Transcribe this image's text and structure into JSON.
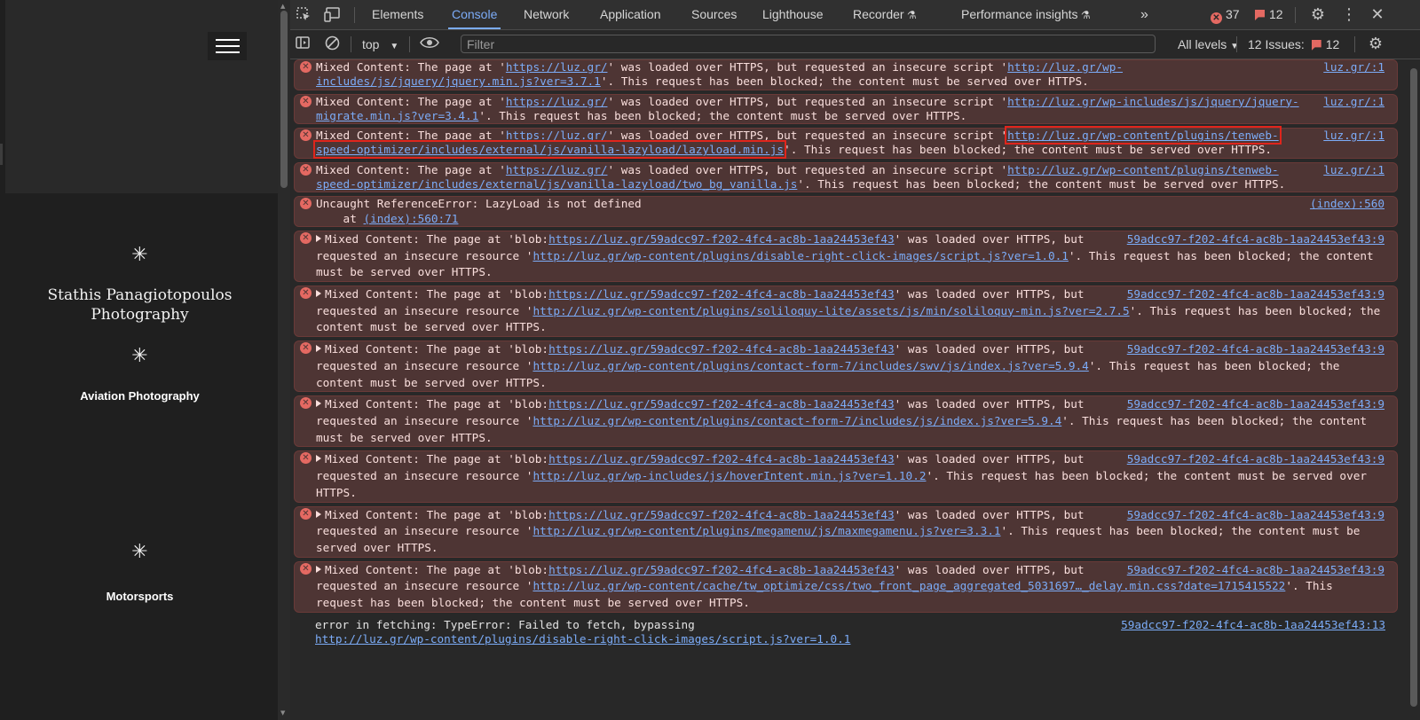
{
  "site": {
    "star": "✳",
    "name_line1": "Stathis Panagiotopoulos",
    "name_line2": "Photography",
    "category1": "Aviation Photography",
    "category2": "Motorsports"
  },
  "devtools": {
    "tabs": [
      "Elements",
      "Console",
      "Network",
      "Application",
      "Sources",
      "Lighthouse",
      "Recorder",
      "Performance insights"
    ],
    "active_tab": "Console",
    "more_tabs": "»",
    "error_count": "37",
    "issue_count": "12",
    "context": "top",
    "filter_placeholder": "Filter",
    "levels": "All levels",
    "issues_label": "12 Issues:",
    "issues_badge": "12"
  },
  "messages": [
    {
      "pre": "Mixed Content: The page at '",
      "page": "https://luz.gr/",
      "mid": "' was loaded over HTTPS, but requested an insecure script '",
      "res": "http://luz.gr/wp-includes/js/jquery/jquery.min.js?ver=3.7.1",
      "post": "'. This request has been blocked; the content must be served over HTTPS.",
      "source": "luz.gr/:1"
    },
    {
      "pre": "Mixed Content: The page at '",
      "page": "https://luz.gr/",
      "mid": "' was loaded over HTTPS, but requested an insecure script '",
      "res": "http://luz.gr/wp-includes/js/jquery/jquery-migrate.min.js?ver=3.4.1",
      "post": "'. This request has been blocked; the content must be served over HTTPS.",
      "source": "luz.gr/:1"
    },
    {
      "pre": "Mixed Content: The page at '",
      "page": "https://luz.gr/",
      "mid": "' was loaded over HTTPS, but requested an insecure script '",
      "res": "http://luz.gr/wp-content/plugins/tenweb-speed-optimizer/includes/external/js/vanilla-lazyload/lazyload.min.js",
      "post": "'. This request has been blocked; the content must be served over HTTPS.",
      "source": "luz.gr/:1"
    },
    {
      "pre": "Mixed Content: The page at '",
      "page": "https://luz.gr/",
      "mid": "' was loaded over HTTPS, but requested an insecure script '",
      "res": "http://luz.gr/wp-content/plugins/tenweb-speed-optimizer/includes/external/js/vanilla-lazyload/two_bg_vanilla.js",
      "post": "'. This request has been blocked; the content must be served over HTTPS.",
      "source": "luz.gr/:1"
    },
    {
      "text": "Uncaught ReferenceError: LazyLoad is not defined",
      "at_prefix": "    at ",
      "at_link": "(index):560:71",
      "source": "(index):560"
    },
    {
      "pre": "Mixed Content: The page at 'blob:",
      "page": "https://luz.gr/59adcc97-f202-4fc4-ac8b-1aa24453ef43",
      "mid": "' was loaded over HTTPS, but requested an insecure resource '",
      "res": "http://luz.gr/wp-content/plugins/disable-right-click-images/script.js?ver=1.0.1",
      "post": "'. This request has been blocked; the content must be served over HTTPS.",
      "source": "59adcc97-f202-4fc4-ac8b-1aa24453ef43:9"
    },
    {
      "pre": "Mixed Content: The page at 'blob:",
      "page": "https://luz.gr/59adcc97-f202-4fc4-ac8b-1aa24453ef43",
      "mid": "' was loaded over HTTPS, but requested an insecure resource '",
      "res": "http://luz.gr/wp-content/plugins/soliloquy-lite/assets/js/min/soliloquy-min.js?ver=2.7.5",
      "post": "'. This request has been blocked; the content must be served over HTTPS.",
      "source": "59adcc97-f202-4fc4-ac8b-1aa24453ef43:9"
    },
    {
      "pre": "Mixed Content: The page at 'blob:",
      "page": "https://luz.gr/59adcc97-f202-4fc4-ac8b-1aa24453ef43",
      "mid": "' was loaded over HTTPS, but requested an insecure resource '",
      "res": "http://luz.gr/wp-content/plugins/contact-form-7/includes/swv/js/index.js?ver=5.9.4",
      "post": "'. This request has been blocked; the content must be served over HTTPS.",
      "source": "59adcc97-f202-4fc4-ac8b-1aa24453ef43:9"
    },
    {
      "pre": "Mixed Content: The page at 'blob:",
      "page": "https://luz.gr/59adcc97-f202-4fc4-ac8b-1aa24453ef43",
      "mid": "' was loaded over HTTPS, but requested an insecure resource '",
      "res": "http://luz.gr/wp-content/plugins/contact-form-7/includes/js/index.js?ver=5.9.4",
      "post": "'. This request has been blocked; the content must be served over HTTPS.",
      "source": "59adcc97-f202-4fc4-ac8b-1aa24453ef43:9"
    },
    {
      "pre": "Mixed Content: The page at 'blob:",
      "page": "https://luz.gr/59adcc97-f202-4fc4-ac8b-1aa24453ef43",
      "mid": "' was loaded over HTTPS, but requested an insecure resource '",
      "res": "http://luz.gr/wp-includes/js/hoverIntent.min.js?ver=1.10.2",
      "post": "'. This request has been blocked; the content must be served over HTTPS.",
      "source": "59adcc97-f202-4fc4-ac8b-1aa24453ef43:9"
    },
    {
      "pre": "Mixed Content: The page at 'blob:",
      "page": "https://luz.gr/59adcc97-f202-4fc4-ac8b-1aa24453ef43",
      "mid": "' was loaded over HTTPS, but requested an insecure resource '",
      "res": "http://luz.gr/wp-content/plugins/megamenu/js/maxmegamenu.js?ver=3.3.1",
      "post": "'. This request has been blocked; the content must be served over HTTPS.",
      "source": "59adcc97-f202-4fc4-ac8b-1aa24453ef43:9"
    },
    {
      "pre": "Mixed Content: The page at 'blob:",
      "page": "https://luz.gr/59adcc97-f202-4fc4-ac8b-1aa24453ef43",
      "mid": "' was loaded over HTTPS, but requested an insecure resource '",
      "res": "http://luz.gr/wp-content/cache/tw_optimize/css/two_front_page_aggregated_5031697…_delay.min.css?date=1715415522",
      "post": "'. This request has been blocked; the content must be served over HTTPS.",
      "source": "59adcc97-f202-4fc4-ac8b-1aa24453ef43:9"
    },
    {
      "text": "error in fetching: TypeError: Failed to fetch, bypassing",
      "link": "http://luz.gr/wp-content/plugins/disable-right-click-images/script.js?ver=1.0.1",
      "source": "59adcc97-f202-4fc4-ac8b-1aa24453ef43:13"
    }
  ],
  "colors": {
    "error_bg": "#4e3534",
    "error_text": "#f9dedc",
    "link": "#7cacf8",
    "accent": "#7cacf8",
    "error_icon": "#e46962",
    "highlight_box": "#e0251c"
  }
}
